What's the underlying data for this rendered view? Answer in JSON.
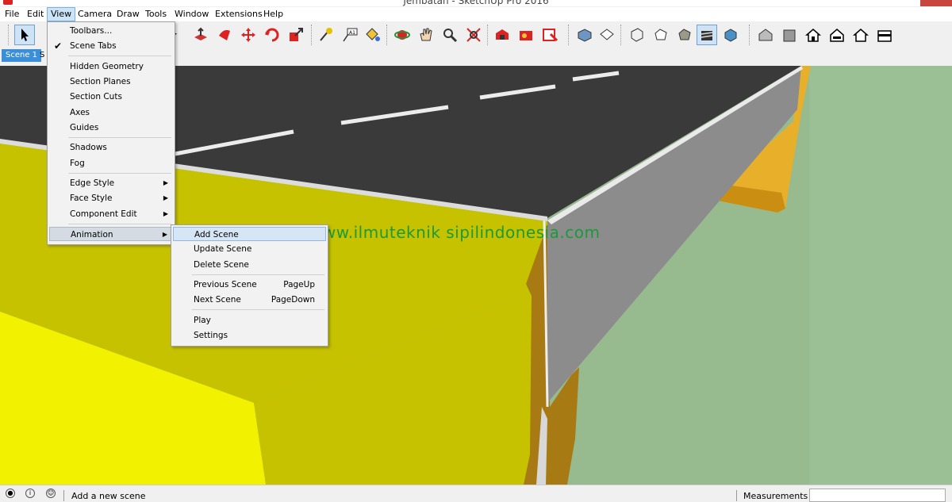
{
  "window": {
    "title": "Jembatan - SketchUp Pro 2016"
  },
  "menubar": {
    "items": [
      "File",
      "Edit",
      "View",
      "Camera",
      "Draw",
      "Tools",
      "Window",
      "Extensions",
      "Help"
    ],
    "active": "View"
  },
  "scenes": {
    "tab1": "Scene 1",
    "tab2_partial": "S"
  },
  "view_menu": {
    "items": [
      {
        "label": "Toolbars...",
        "checked": false,
        "submenu": false
      },
      {
        "label": "Scene Tabs",
        "checked": true,
        "submenu": false
      },
      {
        "label": "Hidden Geometry"
      },
      {
        "label": "Section Planes"
      },
      {
        "label": "Section Cuts"
      },
      {
        "label": "Axes"
      },
      {
        "label": "Guides"
      },
      {
        "label": "Shadows"
      },
      {
        "label": "Fog"
      },
      {
        "label": "Edge Style",
        "submenu": true
      },
      {
        "label": "Face Style",
        "submenu": true
      },
      {
        "label": "Component Edit",
        "submenu": true
      },
      {
        "label": "Animation",
        "submenu": true,
        "active": true
      }
    ]
  },
  "animation_menu": {
    "items": [
      {
        "label": "Add Scene",
        "shortcut": "",
        "highlighted": true
      },
      {
        "label": "Update Scene",
        "shortcut": ""
      },
      {
        "label": "Delete Scene",
        "shortcut": ""
      },
      {
        "label": "Previous Scene",
        "shortcut": "PageUp"
      },
      {
        "label": "Next Scene",
        "shortcut": "PageDown"
      },
      {
        "label": "Play",
        "shortcut": ""
      },
      {
        "label": "Settings",
        "shortcut": ""
      }
    ]
  },
  "viewport": {
    "watermark": "www.ilmuteknik sipilindonesia.com"
  },
  "statusbar": {
    "hint": "Add a new scene",
    "measurements_label": "Measurements",
    "measurements_value": ""
  },
  "colors": {
    "road": "#3a3a3a",
    "deck_side": "#8c8c8c",
    "abutment_top": "#c6c200",
    "abutment_face": "#f2f200",
    "pier": "#a77a14",
    "girder": "#e8b02a",
    "ground": "#97bb8f",
    "accent": "#3a8fd8"
  }
}
